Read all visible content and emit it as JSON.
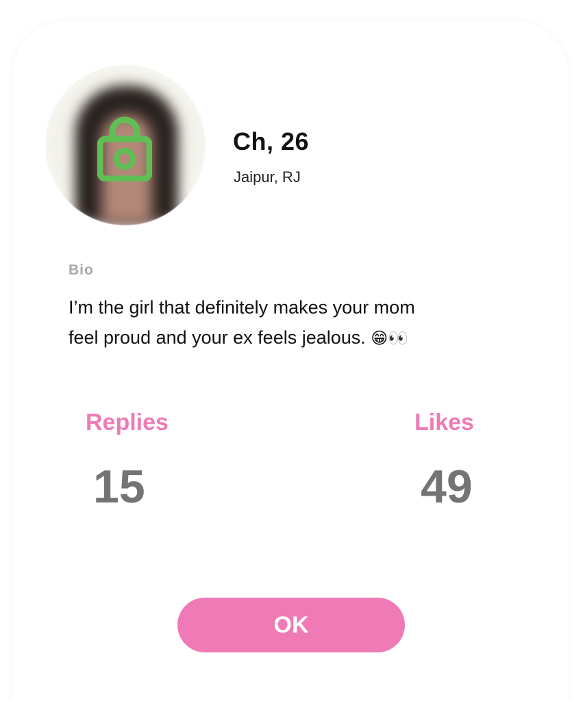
{
  "profile": {
    "name_age": "Ch, 26",
    "location": "Jaipur, RJ",
    "avatar_icon": "blurred-photo",
    "lock_icon": "lock-icon",
    "lock_color": "#5fbf55"
  },
  "bio": {
    "label": "Bio",
    "line1": "I’m the girl that definitely makes your mom",
    "line2": "feel proud and your ex feels jealous.",
    "emojis": "😁👀"
  },
  "stats": {
    "replies_label": "Replies",
    "replies_value": "15",
    "likes_label": "Likes",
    "likes_value": "49"
  },
  "actions": {
    "ok_label": "OK"
  },
  "colors": {
    "accent": "#ef7ab5",
    "stat_value": "#747474",
    "bio_label": "#a6a6a6"
  }
}
